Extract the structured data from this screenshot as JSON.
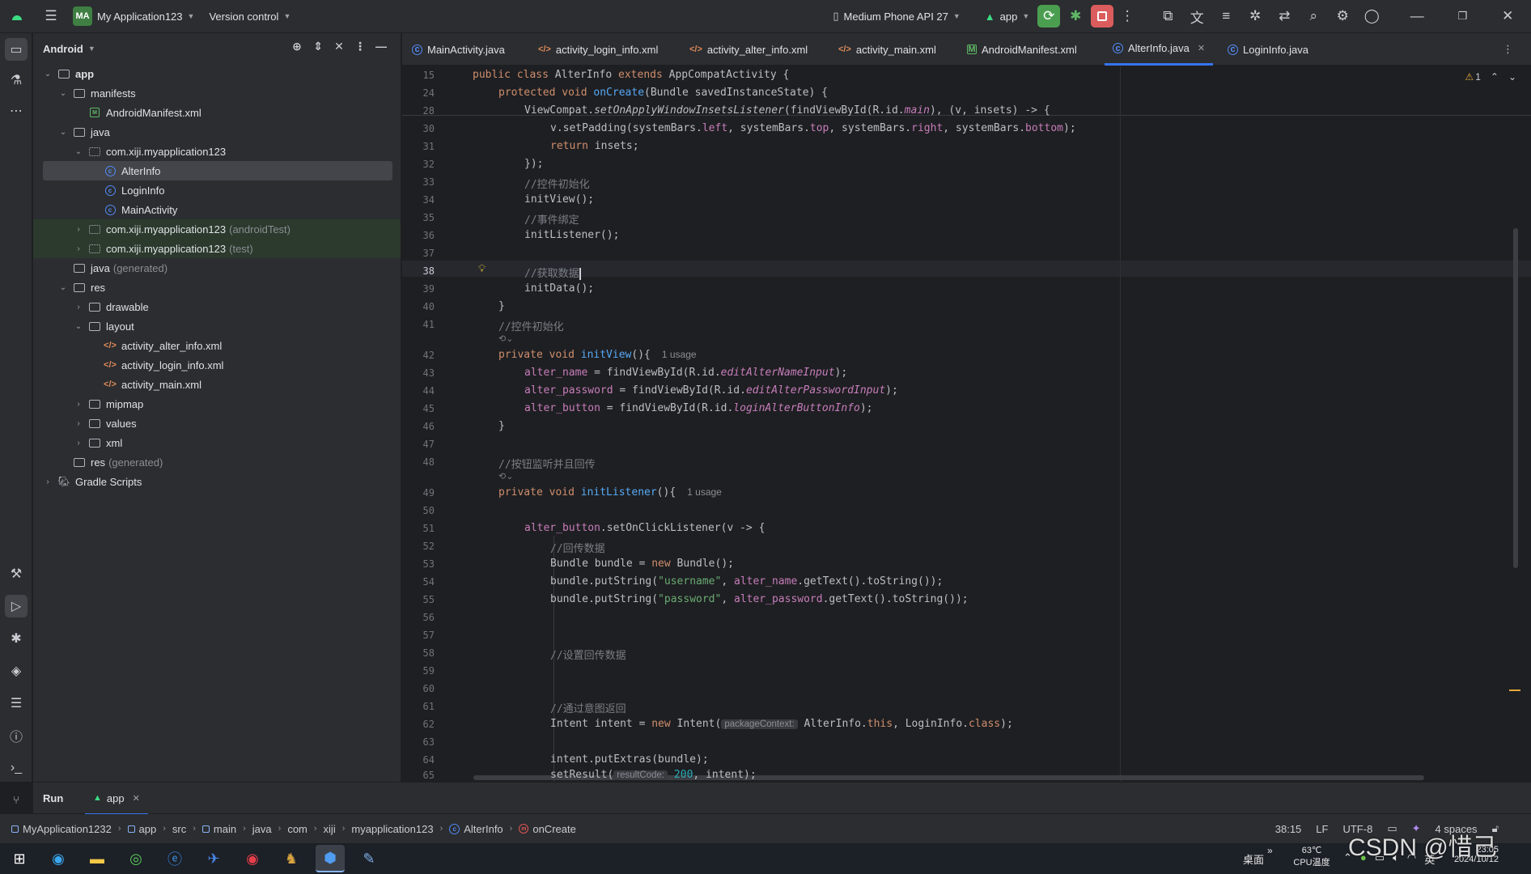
{
  "titlebar": {
    "project_badge": "MA",
    "project_name": "My Application123",
    "vcs": "Version control",
    "device": "Medium Phone API 27",
    "run_config": "app"
  },
  "project_panel": {
    "title": "Android",
    "tree": [
      {
        "label": "app",
        "depth": 0,
        "icon": "folder-icon",
        "expanded": true
      },
      {
        "label": "manifests",
        "depth": 1,
        "icon": "folder-icon",
        "expanded": true
      },
      {
        "label": "AndroidManifest.xml",
        "depth": 2,
        "icon": "manifest-icon"
      },
      {
        "label": "java",
        "depth": 1,
        "icon": "folder-icon",
        "expanded": true
      },
      {
        "label": "com.xiji.myapplication123",
        "depth": 2,
        "icon": "package-icon",
        "expanded": true
      },
      {
        "label": "AlterInfo",
        "depth": 3,
        "icon": "class-icon",
        "selected": true
      },
      {
        "label": "LoginInfo",
        "depth": 3,
        "icon": "class-icon"
      },
      {
        "label": "MainActivity",
        "depth": 3,
        "icon": "class-icon"
      },
      {
        "label": "com.xiji.myapplication123",
        "suffix": "(androidTest)",
        "depth": 2,
        "icon": "package-icon",
        "collapsed": true,
        "test": true
      },
      {
        "label": "com.xiji.myapplication123",
        "suffix": "(test)",
        "depth": 2,
        "icon": "package-icon",
        "collapsed": true,
        "test": true
      },
      {
        "label": "java",
        "suffix": "(generated)",
        "depth": 1,
        "icon": "folder-icon"
      },
      {
        "label": "res",
        "depth": 1,
        "icon": "folder-icon",
        "expanded": true
      },
      {
        "label": "drawable",
        "depth": 2,
        "icon": "folder-icon",
        "collapsed": true
      },
      {
        "label": "layout",
        "depth": 2,
        "icon": "folder-icon",
        "expanded": true
      },
      {
        "label": "activity_alter_info.xml",
        "depth": 3,
        "icon": "xml-icon"
      },
      {
        "label": "activity_login_info.xml",
        "depth": 3,
        "icon": "xml-icon"
      },
      {
        "label": "activity_main.xml",
        "depth": 3,
        "icon": "xml-icon"
      },
      {
        "label": "mipmap",
        "depth": 2,
        "icon": "folder-icon",
        "collapsed": true
      },
      {
        "label": "values",
        "depth": 2,
        "icon": "folder-icon",
        "collapsed": true
      },
      {
        "label": "xml",
        "depth": 2,
        "icon": "folder-icon",
        "collapsed": true
      },
      {
        "label": "res",
        "suffix": "(generated)",
        "depth": 1,
        "icon": "folder-icon"
      },
      {
        "label": "Gradle Scripts",
        "depth": 0,
        "icon": "gradle-icon",
        "collapsed": true
      }
    ]
  },
  "tabs": [
    {
      "label": "MainActivity.java",
      "icon": "class-icon"
    },
    {
      "label": "activity_login_info.xml",
      "icon": "xml-icon"
    },
    {
      "label": "activity_alter_info.xml",
      "icon": "xml-icon"
    },
    {
      "label": "activity_main.xml",
      "icon": "xml-icon"
    },
    {
      "label": "AndroidManifest.xml",
      "icon": "manifest-icon"
    },
    {
      "label": "AlterInfo.java",
      "icon": "class-icon",
      "active": true
    },
    {
      "label": "LoginInfo.java",
      "icon": "class-icon"
    }
  ],
  "editor": {
    "warnings": "1",
    "lines": {
      "l15": "15",
      "l24": "24",
      "l28": "28",
      "l30": "30",
      "l31": "31",
      "l32": "32",
      "l33": "33",
      "l34": "34",
      "l35": "35",
      "l36": "36",
      "l37": "37",
      "l38": "38",
      "l39": "39",
      "l40": "40",
      "l41": "41",
      "l42": "42",
      "l43": "43",
      "l44": "44",
      "l45": "45",
      "l46": "46",
      "l47": "47",
      "l48": "48",
      "l49": "49",
      "l50": "50",
      "l51": "51",
      "l52": "52",
      "l53": "53",
      "l54": "54",
      "l55": "55",
      "l56": "56",
      "l57": "57",
      "l58": "58",
      "l59": "59",
      "l60": "60",
      "l61": "61",
      "l62": "62",
      "l63": "63",
      "l64": "64",
      "l65": "65"
    },
    "code": {
      "c15a": "public class ",
      "c15b": "AlterInfo ",
      "c15c": "extends ",
      "c15d": "AppCompatActivity {",
      "c24a": "protected void ",
      "c24b": "onCreate",
      "c24c": "(Bundle savedInstanceState) {",
      "c28a": "ViewCompat.",
      "c28b": "setOnApplyWindowInsetsListener",
      "c28c": "(findViewById(R.id.",
      "c28d": "main",
      "c28e": "), (v, insets) -> {",
      "c30a": "v.setPadding(systemBars.",
      "c30b": "left",
      "c30c": ", systemBars.",
      "c30d": "top",
      "c30e": ", systemBars.",
      "c30f": "right",
      "c30g": ", systemBars.",
      "c30h": "bottom",
      "c30i": ");",
      "c31a": "return ",
      "c31b": "insets;",
      "c32": "});",
      "c33": "//控件初始化",
      "c34": "initView();",
      "c35": "//事件绑定",
      "c36": "initListener();",
      "c38": "//获取数据",
      "c39": "initData();",
      "c40": "}",
      "c41": "//控件初始化",
      "c42a": "private void ",
      "c42b": "initView",
      "c42c": "(){",
      "c42u": "1 usage",
      "c43a": "alter_name",
      "c43b": " = findViewById(R.id.",
      "c43c": "editAlterNameInput",
      "c43d": ");",
      "c44a": "alter_password",
      "c44b": " = findViewById(R.id.",
      "c44c": "editAlterPasswordInput",
      "c44d": ");",
      "c45a": "alter_button",
      "c45b": " = findViewById(R.id.",
      "c45c": "loginAlterButtonInfo",
      "c45d": ");",
      "c46": "}",
      "c48": "//按钮监听并且回传",
      "c49a": "private void ",
      "c49b": "initListener",
      "c49c": "(){",
      "c49u": "1 usage",
      "c51a": "alter_button",
      "c51b": ".setOnClickListener(v -> {",
      "c52": "//回传数据",
      "c53a": "Bundle bundle = ",
      "c53b": "new ",
      "c53c": "Bundle();",
      "c54a": "bundle.putString(",
      "c54b": "\"username\"",
      "c54c": ", ",
      "c54d": "alter_name",
      "c54e": ".getText().toString());",
      "c55a": "bundle.putString(",
      "c55b": "\"password\"",
      "c55c": ", ",
      "c55d": "alter_password",
      "c55e": ".getText().toString());",
      "c58": "//设置回传数据",
      "c61": "//通过意图返回",
      "c62a": "Intent intent = ",
      "c62b": "new ",
      "c62c": "Intent(",
      "c62h": "packageContext:",
      "c62d": " AlterInfo.",
      "c62e": "this",
      "c62f": ", LoginInfo.",
      "c62g": "class",
      "c62i": ");",
      "c64": "intent.putExtras(bundle);",
      "c65a": "setResult(",
      "c65h": "resultCode:",
      "c65b": " 200",
      "c65c": ", intent);"
    }
  },
  "run": {
    "label": "Run",
    "tab": "app"
  },
  "status": {
    "breadcrumbs": [
      "MyApplication1232",
      "app",
      "src",
      "main",
      "java",
      "com",
      "xiji",
      "myapplication123",
      "AlterInfo",
      "onCreate"
    ],
    "position": "38:15",
    "line_sep": "LF",
    "encoding": "UTF-8",
    "indent": "4 spaces"
  },
  "taskbar": {
    "desktop": "桌面",
    "temp": "63℃",
    "cpu": "CPU温度",
    "ime": "英",
    "time": "23:05",
    "date": "2024/10/12",
    "watermark": "CSDN @惜己"
  }
}
